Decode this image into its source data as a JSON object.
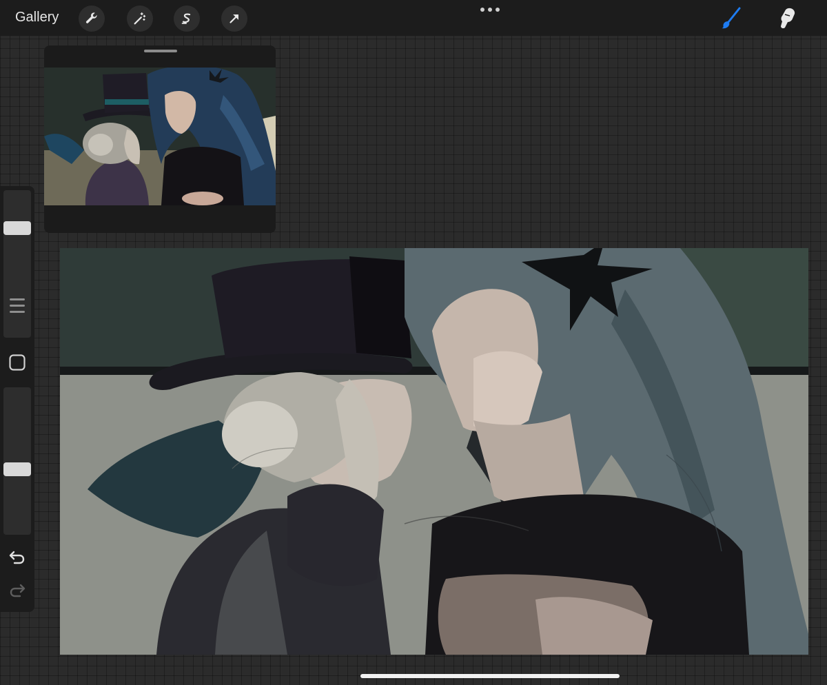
{
  "toolbar": {
    "gallery_label": "Gallery",
    "left_tools": [
      "wrench-icon",
      "magic-wand-icon",
      "selection-icon",
      "transform-arrow-icon"
    ],
    "right_tools": [
      "brush-icon",
      "smudge-icon"
    ],
    "active_tool_color": "#1e7cf2"
  },
  "reference": {
    "image": "reference-illustration"
  },
  "sidebar": {
    "brush_size_level": 0.23,
    "opacity_level": 0.56
  },
  "canvas": {
    "content": "sketch-artwork",
    "palette": [
      "#2f3b38",
      "#8e918a",
      "#171619",
      "#5b6a70",
      "#c8bfb6",
      "#23272b"
    ]
  },
  "colors": {
    "toolbar_bg": "#1c1c1c",
    "workspace_bg": "#2b2b2b",
    "accent": "#1e7cf2"
  }
}
